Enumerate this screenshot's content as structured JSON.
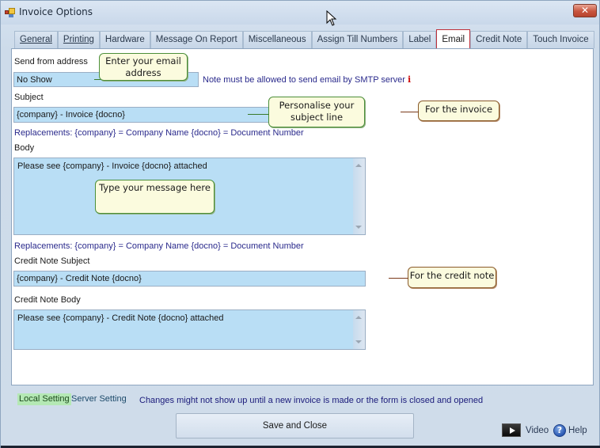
{
  "window": {
    "title": "Invoice Options",
    "close_glyph": "✕"
  },
  "tabs": [
    {
      "label": "General",
      "active": false
    },
    {
      "label": "Printing",
      "active": false
    },
    {
      "label": "Hardware",
      "active": false
    },
    {
      "label": "Message On Report",
      "active": false
    },
    {
      "label": "Miscellaneous",
      "active": false
    },
    {
      "label": "Assign Till Numbers",
      "active": false
    },
    {
      "label": "Label",
      "active": false
    },
    {
      "label": "Email",
      "active": true
    },
    {
      "label": "Credit Note",
      "active": false
    },
    {
      "label": "Touch Invoice",
      "active": false
    }
  ],
  "email": {
    "send_from_label": "Send from address",
    "send_from_value": "No Show",
    "smtp_note": "Note must be allowed to send email by SMTP server",
    "info_glyph": "i",
    "subject_label": "Subject",
    "subject_value": "{company} - Invoice {docno}",
    "replacements_note": "Replacements: {company} = Company Name  {docno} = Document Number",
    "body_label": "Body",
    "body_value": "Please see {company} - Invoice {docno} attached",
    "replacements_note_2": "Replacements: {company} = Company Name  {docno} = Document Number",
    "credit_subject_label": "Credit Note Subject",
    "credit_subject_value": "{company} - Credit Note {docno}",
    "credit_body_label": "Credit Note Body",
    "credit_body_value": "Please see {company} - Credit Note {docno} attached"
  },
  "callouts": {
    "email_address": "Enter your email address",
    "subject_line": "Personalise your subject line",
    "for_invoice": "For the invoice",
    "message": "Type your message here",
    "for_credit_note": "For the credit note"
  },
  "footer": {
    "local_setting": "Local Setting",
    "server_setting": "Server Setting",
    "changes_note": "Changes might not show up until a new invoice is made or the form is closed and opened",
    "save_close": "Save and Close",
    "video": "Video",
    "help": "Help",
    "help_glyph": "?"
  },
  "colors": {
    "field_bg": "#b9def5",
    "active_tab_border": "#c0303a",
    "note_text": "#2a2a8c",
    "local_setting_bg": "#b4e8b4",
    "callout_bg": "#fbfbde"
  }
}
